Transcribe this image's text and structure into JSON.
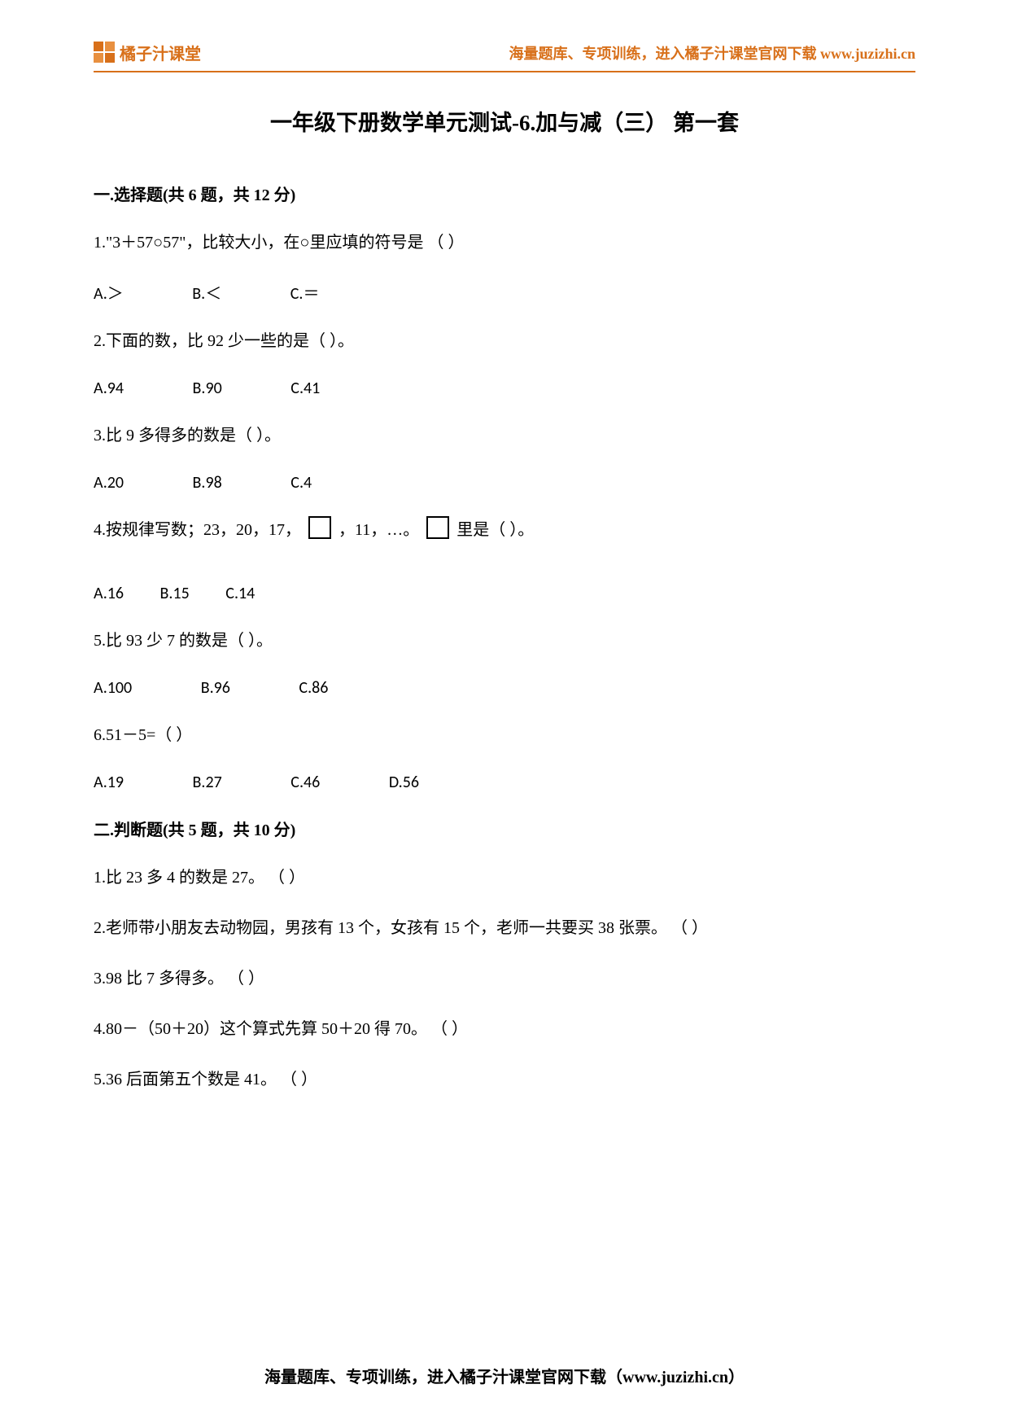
{
  "header": {
    "logo_text": "橘子汁课堂",
    "right_text": "海量题库、专项训练，进入橘子汁课堂官网下载 www.juzizhi.cn"
  },
  "title": "一年级下册数学单元测试-6.加与减（三） 第一套",
  "section1": {
    "heading": "一.选择题(共 6 题，共 12 分)",
    "q1": {
      "text": "1.\"3＋57○57\"，比较大小，在○里应填的符号是 （  ）",
      "optA": "A.＞",
      "optB": "B.＜",
      "optC": "C.＝"
    },
    "q2": {
      "text": "2.下面的数，比 92 少一些的是（   ）。",
      "optA": "A.94",
      "optB": "B.90",
      "optC": "C.41"
    },
    "q3": {
      "text": "3.比 9 多得多的数是（  ）。",
      "optA": "A.20",
      "optB": "B.98",
      "optC": "C.4"
    },
    "q4": {
      "prefix": "4.按规律写数；23，20，17，",
      "mid": "，11，…。",
      "suffix": "里是（  ）。",
      "optA": "A.16",
      "optB": "B.15",
      "optC": "C.14"
    },
    "q5": {
      "text": "5.比 93 少 7 的数是（  ）。",
      "optA": "A.100",
      "optB": "B.96",
      "optC": "C.86"
    },
    "q6": {
      "text": "6.51－5=（  ）",
      "optA": "A.19",
      "optB": "B.27",
      "optC": "C.46",
      "optD": "D.56"
    }
  },
  "section2": {
    "heading": "二.判断题(共 5 题，共 10 分)",
    "j1": "1.比 23 多 4 的数是 27。     （   ）",
    "j2": "2.老师带小朋友去动物园，男孩有 13 个，女孩有 15 个，老师一共要买 38 张票。     （   ）",
    "j3": "3.98 比 7 多得多。   （   ）",
    "j4": "4.80－（50＋20）这个算式先算 50＋20 得 70。     （   ）",
    "j5": "5.36 后面第五个数是 41。     （   ）"
  },
  "footer": "海量题库、专项训练，进入橘子汁课堂官网下载（www.juzizhi.cn）"
}
